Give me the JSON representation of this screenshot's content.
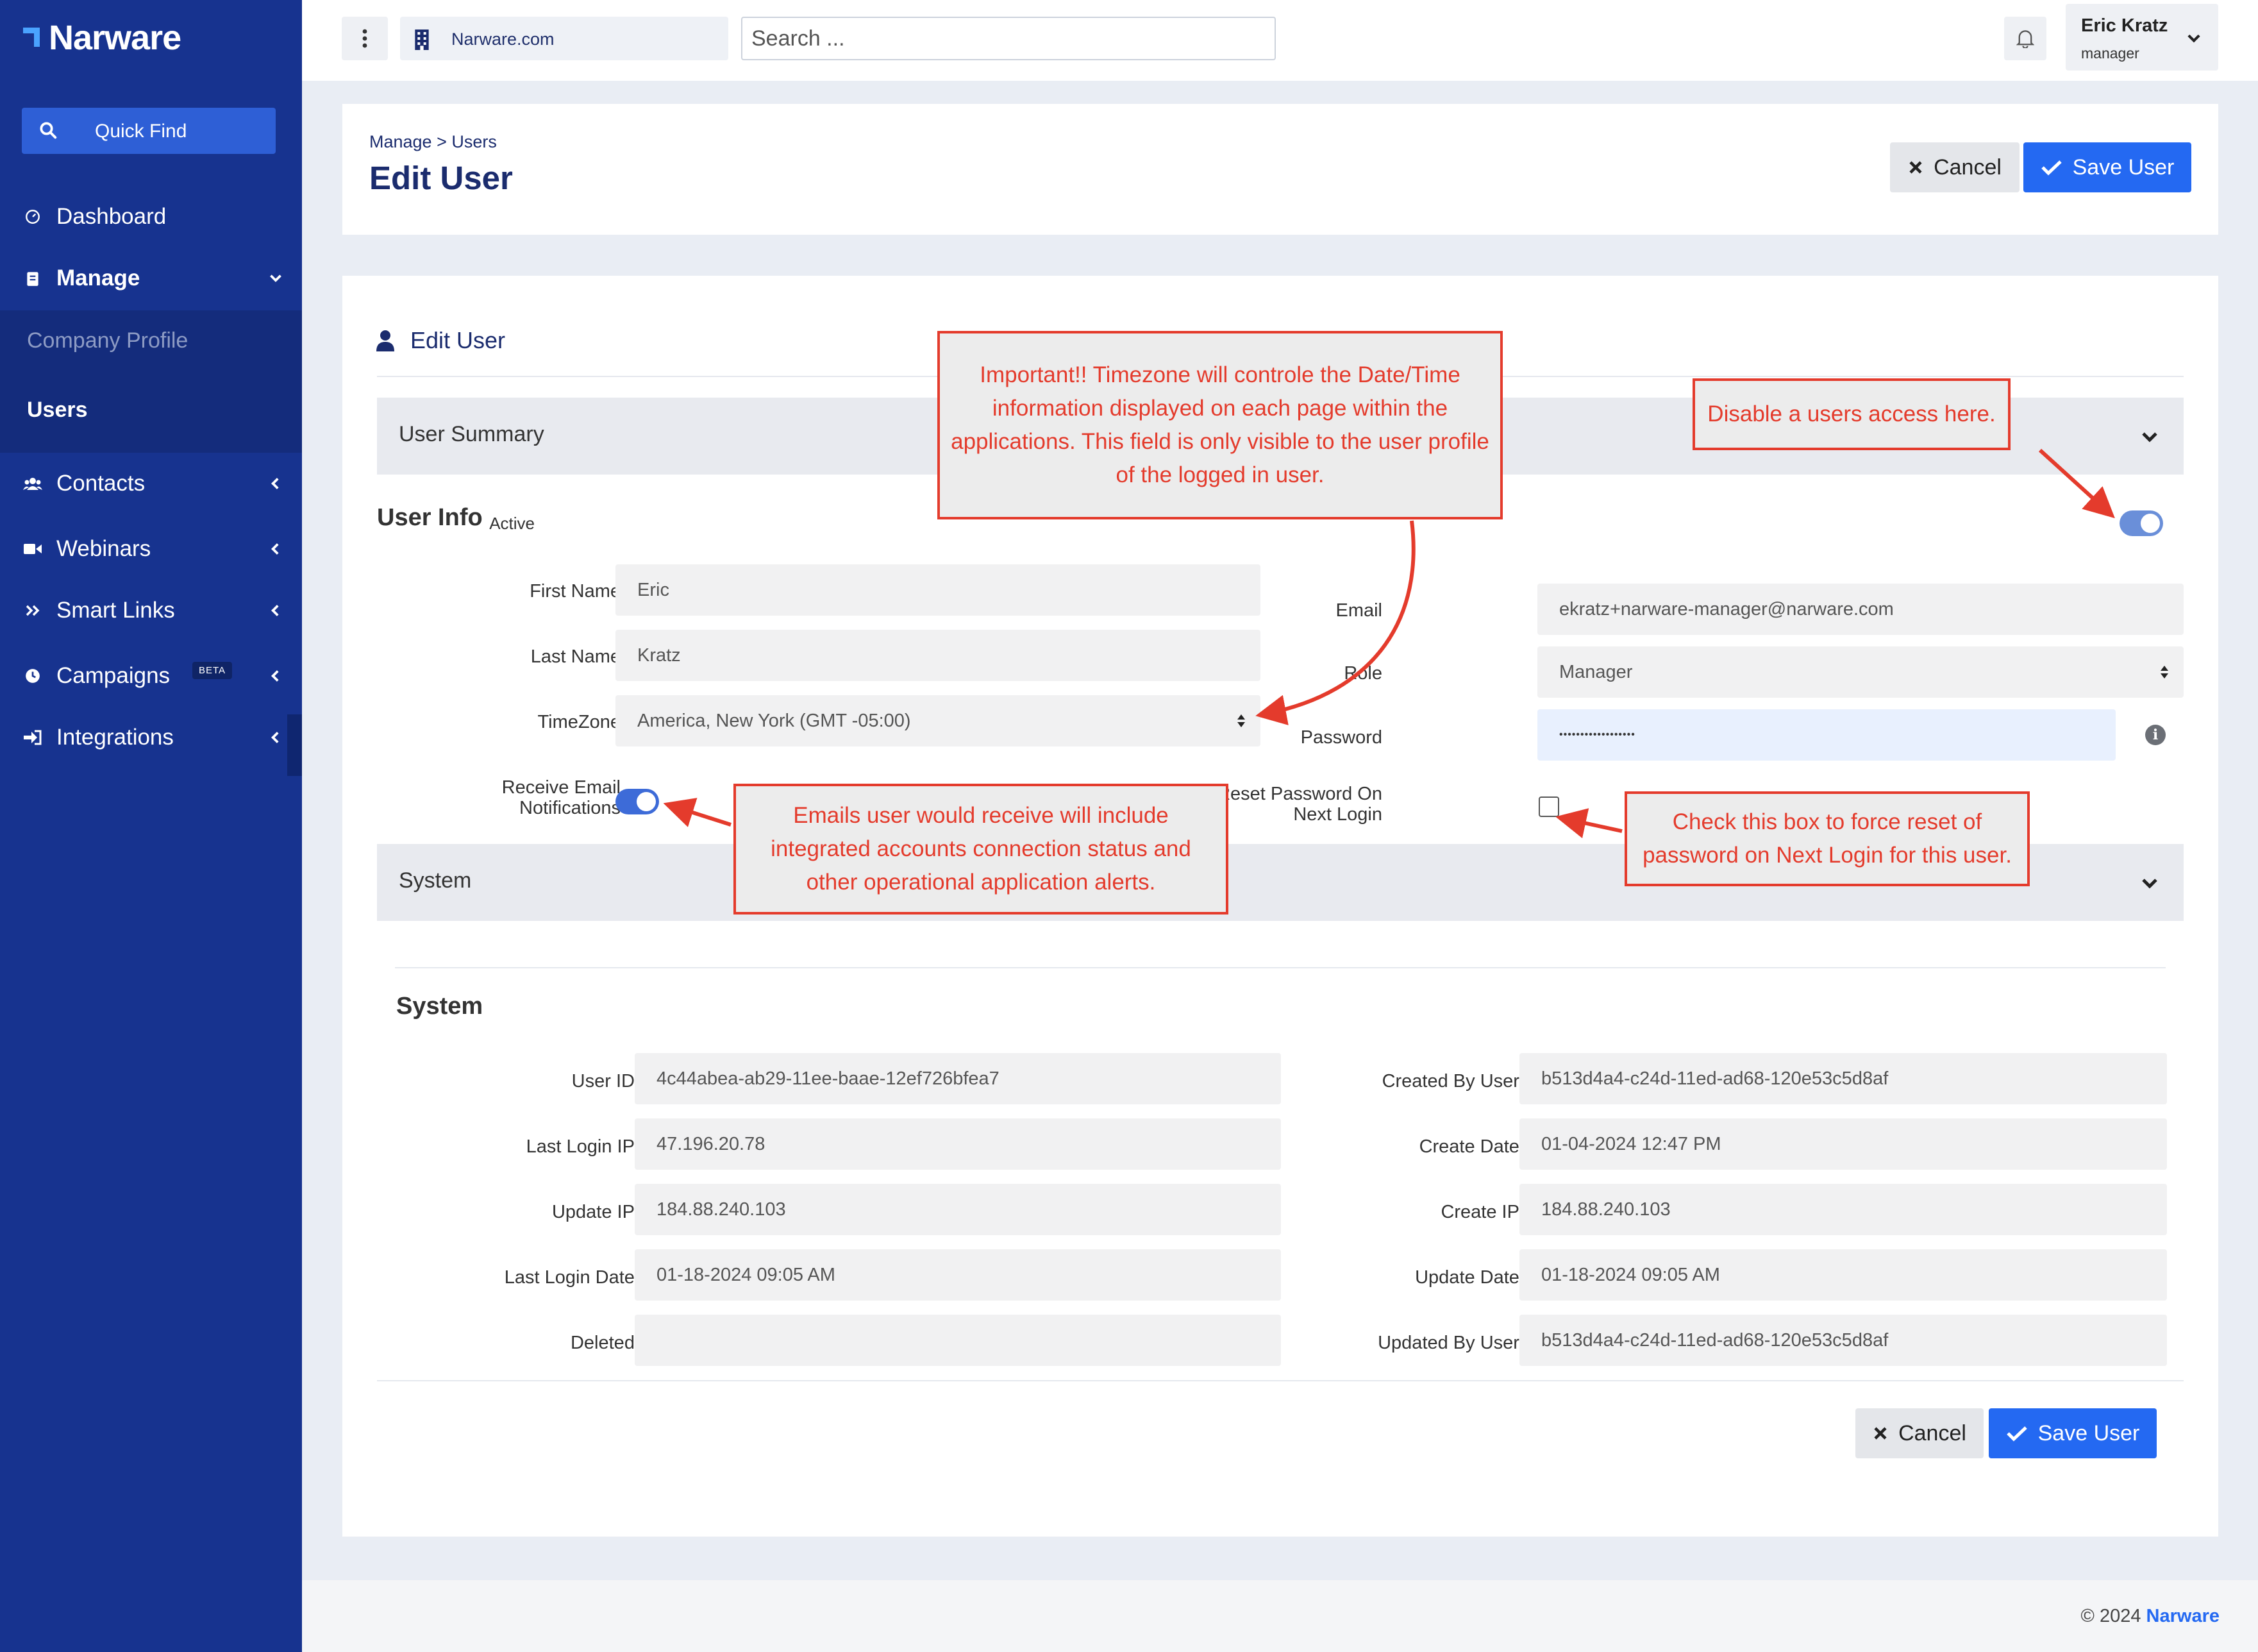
{
  "app": {
    "logo_text": "Narware",
    "brand_color": "#17338f",
    "accent": "#2469f2"
  },
  "sidebar": {
    "quick_find": "Quick Find",
    "items": [
      {
        "label": "Dashboard",
        "icon": "dashboard-icon"
      },
      {
        "label": "Manage",
        "icon": "clipboard-icon"
      },
      {
        "label": "Contacts",
        "icon": "users-icon"
      },
      {
        "label": "Webinars",
        "icon": "video-icon"
      },
      {
        "label": "Smart Links",
        "icon": "double-chevron-icon"
      },
      {
        "label": "Campaigns",
        "icon": "clock-icon",
        "badge": "BETA"
      },
      {
        "label": "Integrations",
        "icon": "sign-in-icon"
      }
    ],
    "submenu": [
      {
        "label": "Company Profile"
      },
      {
        "label": "Users"
      }
    ]
  },
  "topbar": {
    "site": "Narware.com",
    "search_placeholder": "Search ...",
    "user_name": "Eric Kratz",
    "user_role": "manager"
  },
  "page": {
    "breadcrumb": "Manage > Users",
    "title": "Edit User",
    "cancel_label": "Cancel",
    "save_label": "Save User"
  },
  "form": {
    "card_title": "Edit User",
    "user_summary": "User Summary",
    "user_info": "User Info",
    "active_label": "Active",
    "first_name_label": "First Name",
    "first_name": "Eric",
    "last_name_label": "Last Name",
    "last_name": "Kratz",
    "timezone_label": "TimeZone",
    "timezone": "America, New York (GMT -05:00)",
    "email_notif_label_1": "Receive Email",
    "email_notif_label_2": "Notifications",
    "email_label": "Email",
    "email": "ekratz+narware-manager@narware.com",
    "role_label": "Role",
    "role": "Manager",
    "password_label": "Password",
    "password": "••••••••••••••••••",
    "reset_label_1": "Reset Password On",
    "reset_label_2": "Next Login",
    "system_accordion": "System"
  },
  "system": {
    "title": "System",
    "user_id_label": "User ID:",
    "user_id": "4c44abea-ab29-11ee-baae-12ef726bfea7",
    "last_login_ip_label": "Last Login IP:",
    "last_login_ip": "47.196.20.78",
    "update_ip_label": "Update IP:",
    "update_ip": "184.88.240.103",
    "last_login_date_label": "Last Login Date:",
    "last_login_date": "01-18-2024 09:05 AM",
    "deleted_label": "Deleted:",
    "deleted": "",
    "created_by_label": "Created By User:",
    "created_by": "b513d4a4-c24d-11ed-ad68-120e53c5d8af",
    "create_date_label": "Create Date:",
    "create_date": "01-04-2024 12:47 PM",
    "create_ip_label": "Create IP:",
    "create_ip": "184.88.240.103",
    "update_date_label": "Update Date:",
    "update_date": "01-18-2024 09:05 AM",
    "updated_by_label": "Updated By User:",
    "updated_by": "b513d4a4-c24d-11ed-ad68-120e53c5d8af"
  },
  "annotations": {
    "timezone_note": "Important!! Timezone will controle the Date/Time information displayed on each page within the applications. This field is only visible to the user profile of the logged in user.",
    "active_note": "Disable a users access here.",
    "email_note": "Emails user would receive will include integrated accounts connection status and other  operational application alerts.",
    "reset_note": "Check this box to force reset of password on Next Login for this user.",
    "color": "#e43b2c"
  },
  "footer": {
    "copyright": "© 2024",
    "brand": "Narware"
  }
}
